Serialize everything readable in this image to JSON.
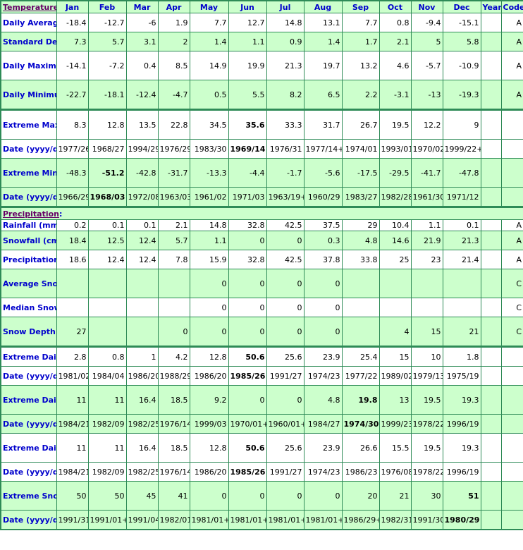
{
  "colors": {
    "border": "#2e8b57",
    "green_row": "#ccffcc",
    "label_text": "#0000cc",
    "section_link": "#660066"
  },
  "columns": [
    "Jan",
    "Feb",
    "Mar",
    "Apr",
    "May",
    "Jun",
    "Jul",
    "Aug",
    "Sep",
    "Oct",
    "Nov",
    "Dec",
    "Year",
    "Code"
  ],
  "sections": [
    {
      "title": "Temperature",
      "rows": [
        {
          "label": "Daily Average (°C)",
          "values": [
            "-18.4",
            "-12.7",
            "-6",
            "1.9",
            "7.7",
            "12.7",
            "14.8",
            "13.1",
            "7.7",
            "0.8",
            "-9.4",
            "-15.1",
            "",
            "A"
          ],
          "bold": []
        },
        {
          "label": "Standard Deviation",
          "values": [
            "7.3",
            "5.7",
            "3.1",
            "2",
            "1.4",
            "1.1",
            "0.9",
            "1.4",
            "1.7",
            "2.1",
            "5",
            "5.8",
            "",
            "A"
          ],
          "bold": []
        },
        {
          "label": "Daily Maximum (°C)",
          "values": [
            "-14.1",
            "-7.2",
            "0.4",
            "8.5",
            "14.9",
            "19.9",
            "21.3",
            "19.7",
            "13.2",
            "4.6",
            "-5.7",
            "-10.9",
            "",
            "A"
          ],
          "bold": []
        },
        {
          "label": "Daily Minimum (°C)",
          "values": [
            "-22.7",
            "-18.1",
            "-12.4",
            "-4.7",
            "0.5",
            "5.5",
            "8.2",
            "6.5",
            "2.2",
            "-3.1",
            "-13",
            "-19.3",
            "",
            "A"
          ],
          "bold": []
        },
        {
          "label": "Extreme Maximum (°C)",
          "values": [
            "8.3",
            "12.8",
            "13.5",
            "22.8",
            "34.5",
            "35.6",
            "33.3",
            "31.7",
            "26.7",
            "19.5",
            "12.2",
            "9",
            "",
            ""
          ],
          "bold": [
            5
          ]
        },
        {
          "label": "Date (yyyy/dd)",
          "values": [
            "1977/26",
            "1968/27",
            "1994/29",
            "1976/29",
            "1983/30",
            "1969/14",
            "1976/31",
            "1977/14+",
            "1974/01",
            "1993/01",
            "1970/02",
            "1999/22+",
            "",
            ""
          ],
          "bold": [
            5
          ]
        },
        {
          "label": "Extreme Minimum (°C)",
          "values": [
            "-48.3",
            "-51.2",
            "-42.8",
            "-31.7",
            "-13.3",
            "-4.4",
            "-1.7",
            "-5.6",
            "-17.5",
            "-29.5",
            "-41.7",
            "-47.8",
            "",
            ""
          ],
          "bold": [
            1
          ]
        },
        {
          "label": "Date (yyyy/dd)",
          "values": [
            "1966/29",
            "1968/03",
            "1972/08",
            "1963/03",
            "1961/02",
            "1971/03",
            "1963/19+",
            "1960/29",
            "1983/27",
            "1982/28",
            "1961/30",
            "1971/12",
            "",
            ""
          ],
          "bold": [
            1
          ]
        }
      ]
    },
    {
      "title": "Precipitation",
      "rows": [
        {
          "label": "Rainfall (mm)",
          "values": [
            "0.2",
            "0.1",
            "0.1",
            "2.1",
            "14.8",
            "32.8",
            "42.5",
            "37.5",
            "29",
            "10.4",
            "1.1",
            "0.1",
            "",
            "A"
          ],
          "bold": []
        },
        {
          "label": "Snowfall (cm)",
          "values": [
            "18.4",
            "12.5",
            "12.4",
            "5.7",
            "1.1",
            "0",
            "0",
            "0.3",
            "4.8",
            "14.6",
            "21.9",
            "21.3",
            "",
            "A"
          ],
          "bold": []
        },
        {
          "label": "Precipitation (mm)",
          "values": [
            "18.6",
            "12.4",
            "12.4",
            "7.8",
            "15.9",
            "32.8",
            "42.5",
            "37.8",
            "33.8",
            "25",
            "23",
            "21.4",
            "",
            "A"
          ],
          "bold": []
        },
        {
          "label": "Average Snow Depth (cm)",
          "values": [
            "",
            "",
            "",
            "",
            "0",
            "0",
            "0",
            "0",
            "",
            "",
            "",
            "",
            "",
            "C"
          ],
          "bold": []
        },
        {
          "label": "Median Snow Depth (cm)",
          "values": [
            "",
            "",
            "",
            "",
            "0",
            "0",
            "0",
            "0",
            "",
            "",
            "",
            "",
            "",
            "C"
          ],
          "bold": []
        },
        {
          "label": "Snow Depth at Month-end (cm)",
          "values": [
            "27",
            "",
            "",
            "0",
            "0",
            "0",
            "0",
            "0",
            "",
            "4",
            "15",
            "21",
            "",
            "C"
          ],
          "bold": []
        },
        {
          "label": "Extreme Daily Rainfall (mm)",
          "values": [
            "2.8",
            "0.8",
            "1",
            "4.2",
            "12.8",
            "50.6",
            "25.6",
            "23.9",
            "25.4",
            "15",
            "10",
            "1.8",
            "",
            ""
          ],
          "bold": [
            5
          ]
        },
        {
          "label": "Date (yyyy/dd)",
          "values": [
            "1981/02",
            "1984/04",
            "1986/20",
            "1988/29",
            "1986/20",
            "1985/26",
            "1991/27",
            "1974/23",
            "1977/22",
            "1989/02",
            "1979/13",
            "1975/19",
            "",
            ""
          ],
          "bold": [
            5
          ]
        },
        {
          "label": "Extreme Daily Snowfall (cm)",
          "values": [
            "11",
            "11",
            "16.4",
            "18.5",
            "9.2",
            "0",
            "0",
            "4.8",
            "19.8",
            "13",
            "19.5",
            "19.3",
            "",
            ""
          ],
          "bold": [
            8
          ]
        },
        {
          "label": "Date (yyyy/dd)",
          "values": [
            "1984/21",
            "1982/09",
            "1982/25",
            "1976/14",
            "1999/03",
            "1970/01+",
            "1960/01+",
            "1984/27",
            "1974/30",
            "1999/23",
            "1978/22",
            "1996/19",
            "",
            ""
          ],
          "bold": [
            8
          ]
        },
        {
          "label": "Extreme Daily Precipitation (mm)",
          "values": [
            "11",
            "11",
            "16.4",
            "18.5",
            "12.8",
            "50.6",
            "25.6",
            "23.9",
            "26.6",
            "15.5",
            "19.5",
            "19.3",
            "",
            ""
          ],
          "bold": [
            5
          ]
        },
        {
          "label": "Date (yyyy/dd)",
          "values": [
            "1984/21",
            "1982/09",
            "1982/25",
            "1976/14",
            "1986/20",
            "1985/26",
            "1991/27",
            "1974/23",
            "1986/23",
            "1976/08",
            "1978/22",
            "1996/19",
            "",
            ""
          ],
          "bold": [
            5
          ]
        },
        {
          "label": "Extreme Snow Depth (cm)",
          "values": [
            "50",
            "50",
            "45",
            "41",
            "0",
            "0",
            "0",
            "0",
            "20",
            "21",
            "30",
            "51",
            "",
            ""
          ],
          "bold": [
            11
          ]
        },
        {
          "label": "Date (yyyy/dd)",
          "values": [
            "1991/31",
            "1991/01+",
            "1991/04",
            "1982/01",
            "1981/01+",
            "1981/01+",
            "1981/01+",
            "1981/01+",
            "1986/29+",
            "1982/31",
            "1991/30",
            "1980/29",
            "",
            ""
          ],
          "bold": [
            11
          ]
        }
      ]
    }
  ]
}
